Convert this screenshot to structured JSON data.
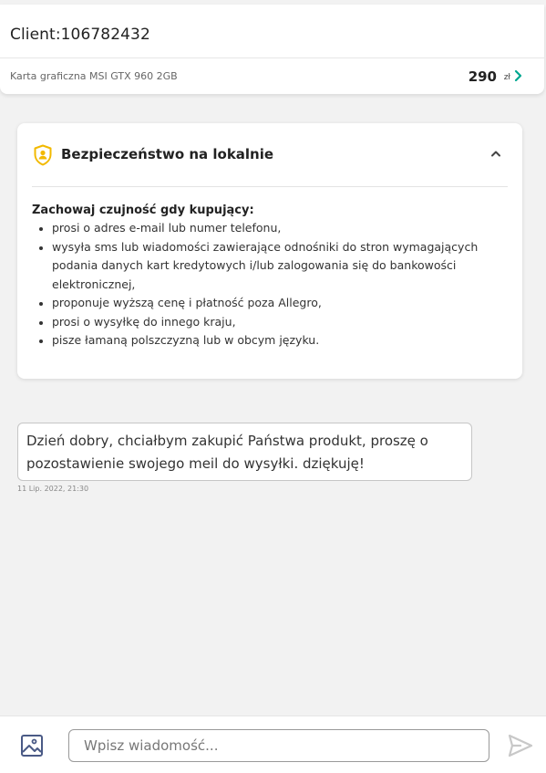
{
  "header": {
    "client_title": "Client:106782432",
    "offer": {
      "name": "Karta graficzna MSI GTX 960 2GB",
      "price": "290",
      "currency": "zł"
    }
  },
  "security": {
    "title": "Bezpieczeństwo na lokalnie",
    "subtitle": "Zachowaj czujność gdy kupujący:",
    "items": [
      "prosi o adres e-mail lub numer telefonu,",
      "wysyła sms lub wiadomości zawierające odnośniki do stron wymagających podania danych kart kredytowych i/lub zalogowania się do bankowości elektronicznej,",
      "proponuje wyższą cenę i płatność poza Allegro,",
      "prosi o wysyłkę do innego kraju,",
      "pisze łamaną polszczyzną lub w obcym języku."
    ],
    "icon": "shield-user-icon",
    "icon_color": "#f2b900"
  },
  "messages": [
    {
      "text": "Dzień dobry, chciałbym zakupić Państwa produkt, proszę o pozostawienie swojego meil do wysyłki. dziękuję!",
      "timestamp": "11 Lip. 2022, 21:30"
    }
  ],
  "composer": {
    "placeholder": "Wpisz wiadomość...",
    "value": "",
    "image_icon": "image-icon",
    "send_icon": "send-icon"
  },
  "colors": {
    "accent": "#00a790",
    "background": "#f2f2f2",
    "send_icon": "#c8c8c8"
  }
}
